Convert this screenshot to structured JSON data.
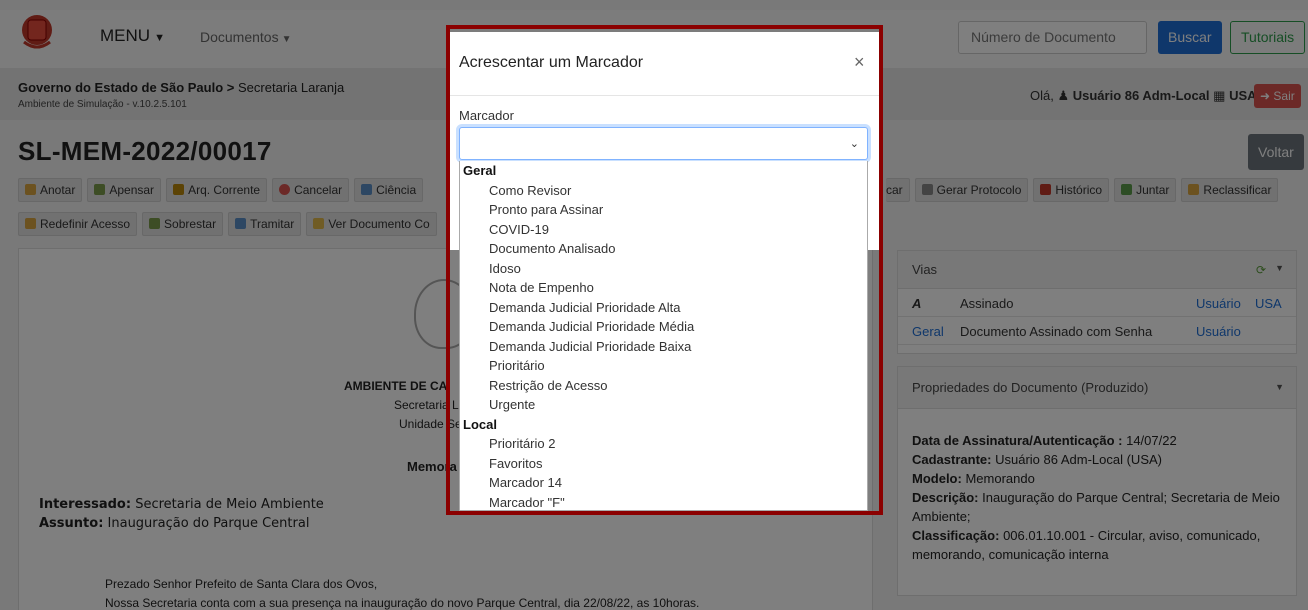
{
  "navbar": {
    "menu_label": "MENU",
    "documents_label": "Documentos",
    "search_placeholder": "Número de Documento",
    "search_button": "Buscar",
    "tutorials_button": "Tutoriais"
  },
  "subheader": {
    "breadcrumb_org": "Governo do Estado de São Paulo",
    "breadcrumb_sep": ">",
    "breadcrumb_unit": "Secretaria Laranja",
    "environment": "Ambiente de Simulação - v.10.2.5.101",
    "greeting": "Olá,",
    "user": "Usuário 86 Adm-Local",
    "location": "USA",
    "logout_button": "Sair"
  },
  "document": {
    "title": "SL-MEM-2022/00017",
    "back_button": "Voltar"
  },
  "toolbar_row1": [
    "Anotar",
    "Apensar",
    "Arq. Corrente",
    "Cancelar",
    "Ciência"
  ],
  "toolbar_row1_right": [
    "car",
    "Gerar Protocolo",
    "Histórico",
    "Juntar",
    "Reclassificar"
  ],
  "toolbar_row2": [
    "Redefinir Acesso",
    "Sobrestar",
    "Tramitar",
    "Ver Documento Co"
  ],
  "doc_content": {
    "header_line1": "AMBIENTE DE CA",
    "header_line2": "Secretaria L",
    "header_line3": "Unidade Se",
    "doc_type": "Memora",
    "interessado_label": "Interessado:",
    "interessado_value": "Secretaria de Meio Ambiente",
    "assunto_label": "Assunto:",
    "assunto_value": "Inauguração do Parque Central",
    "salutation": "Prezado Senhor Prefeito de Santa Clara dos Ovos,",
    "body": "Nossa Secretaria conta com a sua presença na inauguração do novo Parque Central, dia 22/08/22, as 10horas."
  },
  "vias": {
    "title": "Vias",
    "rows": [
      {
        "c1": "A",
        "c2": "Assinado",
        "c3": "Usuário",
        "c4": "USA"
      },
      {
        "c1": "Geral",
        "c2": "Documento Assinado com Senha",
        "c3": "Usuário",
        "c4": ""
      }
    ]
  },
  "properties": {
    "title": "Propriedades do Documento (Produzido)",
    "signature_label": "Data de Assinatura/Autenticação :",
    "signature_value": "14/07/22",
    "registrant_label": "Cadastrante:",
    "registrant_value": "Usuário 86 Adm-Local (USA)",
    "model_label": "Modelo:",
    "model_value": "Memorando",
    "description_label": "Descrição:",
    "description_value": "Inauguração do Parque Central; Secretaria de Meio Ambiente;",
    "classification_label": "Classificação:",
    "classification_value": "006.01.10.001 - Circular, aviso, comunicado, memorando, comunicação interna"
  },
  "modal": {
    "title": "Acrescentar um Marcador",
    "close": "×",
    "field_label": "Marcador",
    "groups": [
      {
        "name": "Geral",
        "options": [
          "Como Revisor",
          "Pronto para Assinar",
          "COVID-19",
          "Documento Analisado",
          "Idoso",
          "Nota de Empenho",
          "Demanda Judicial Prioridade Alta",
          "Demanda Judicial Prioridade Média",
          "Demanda Judicial Prioridade Baixa",
          "Prioritário",
          "Restrição de Acesso",
          "Urgente"
        ]
      },
      {
        "name": "Local",
        "options": [
          "Prioritário 2",
          "Favoritos",
          "Marcador 14",
          "Marcador \"F\""
        ]
      }
    ]
  },
  "colors": {
    "primary": "#1f6fd6",
    "success": "#2d9c4b",
    "danger": "#d9534f",
    "highlight_border": "#8b0000"
  }
}
